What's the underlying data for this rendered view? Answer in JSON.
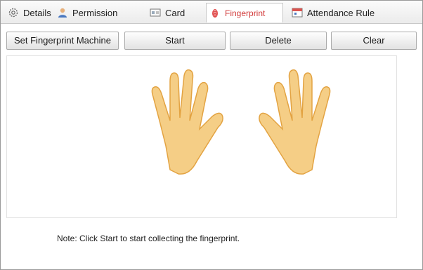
{
  "tabs": [
    {
      "label": "Details",
      "icon": "gear-icon",
      "active": false
    },
    {
      "label": "Permission",
      "icon": "user-icon",
      "active": false
    },
    {
      "label": "Card",
      "icon": "card-icon",
      "active": false
    },
    {
      "label": "Fingerprint",
      "icon": "fingerprint-icon",
      "active": true
    },
    {
      "label": "Attendance Rule",
      "icon": "calendar-icon",
      "active": false
    }
  ],
  "toolbar": {
    "set_machine_label": "Set Fingerprint Machine",
    "start_label": "Start",
    "delete_label": "Delete",
    "clear_label": "Clear"
  },
  "note": "Note: Click Start to start collecting the fingerprint.",
  "colors": {
    "active_tab_text": "#d23a3a",
    "hand_fill": "#f4c97a",
    "hand_stroke": "#e09a2e"
  }
}
